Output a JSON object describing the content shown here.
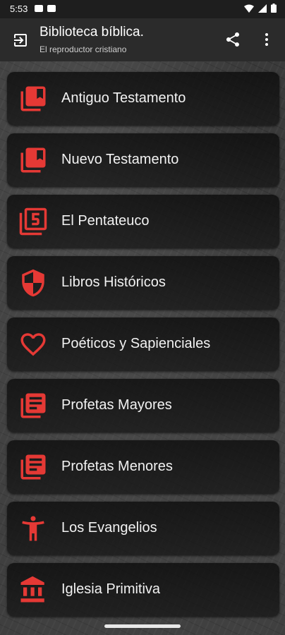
{
  "status_bar": {
    "time": "5:53"
  },
  "app_bar": {
    "title": "Biblioteca bíblica.",
    "subtitle": "El reproductor cristiano"
  },
  "menu": {
    "items": [
      {
        "label": "Antiguo Testamento",
        "icon": "book-stack-icon"
      },
      {
        "label": "Nuevo Testamento",
        "icon": "book-stack-icon"
      },
      {
        "label": "El Pentateuco",
        "icon": "filter-5-icon"
      },
      {
        "label": "Libros Históricos",
        "icon": "shield-icon"
      },
      {
        "label": "Poéticos y Sapienciales",
        "icon": "heart-icon"
      },
      {
        "label": "Profetas Mayores",
        "icon": "library-books-icon"
      },
      {
        "label": "Profetas Menores",
        "icon": "library-books-icon"
      },
      {
        "label": "Los Evangelios",
        "icon": "person-icon"
      },
      {
        "label": "Iglesia Primitiva",
        "icon": "institution-icon"
      }
    ]
  },
  "colors": {
    "accent": "#e53935",
    "app_bar": "#2b2b2b",
    "text": "#f2f2f2"
  }
}
